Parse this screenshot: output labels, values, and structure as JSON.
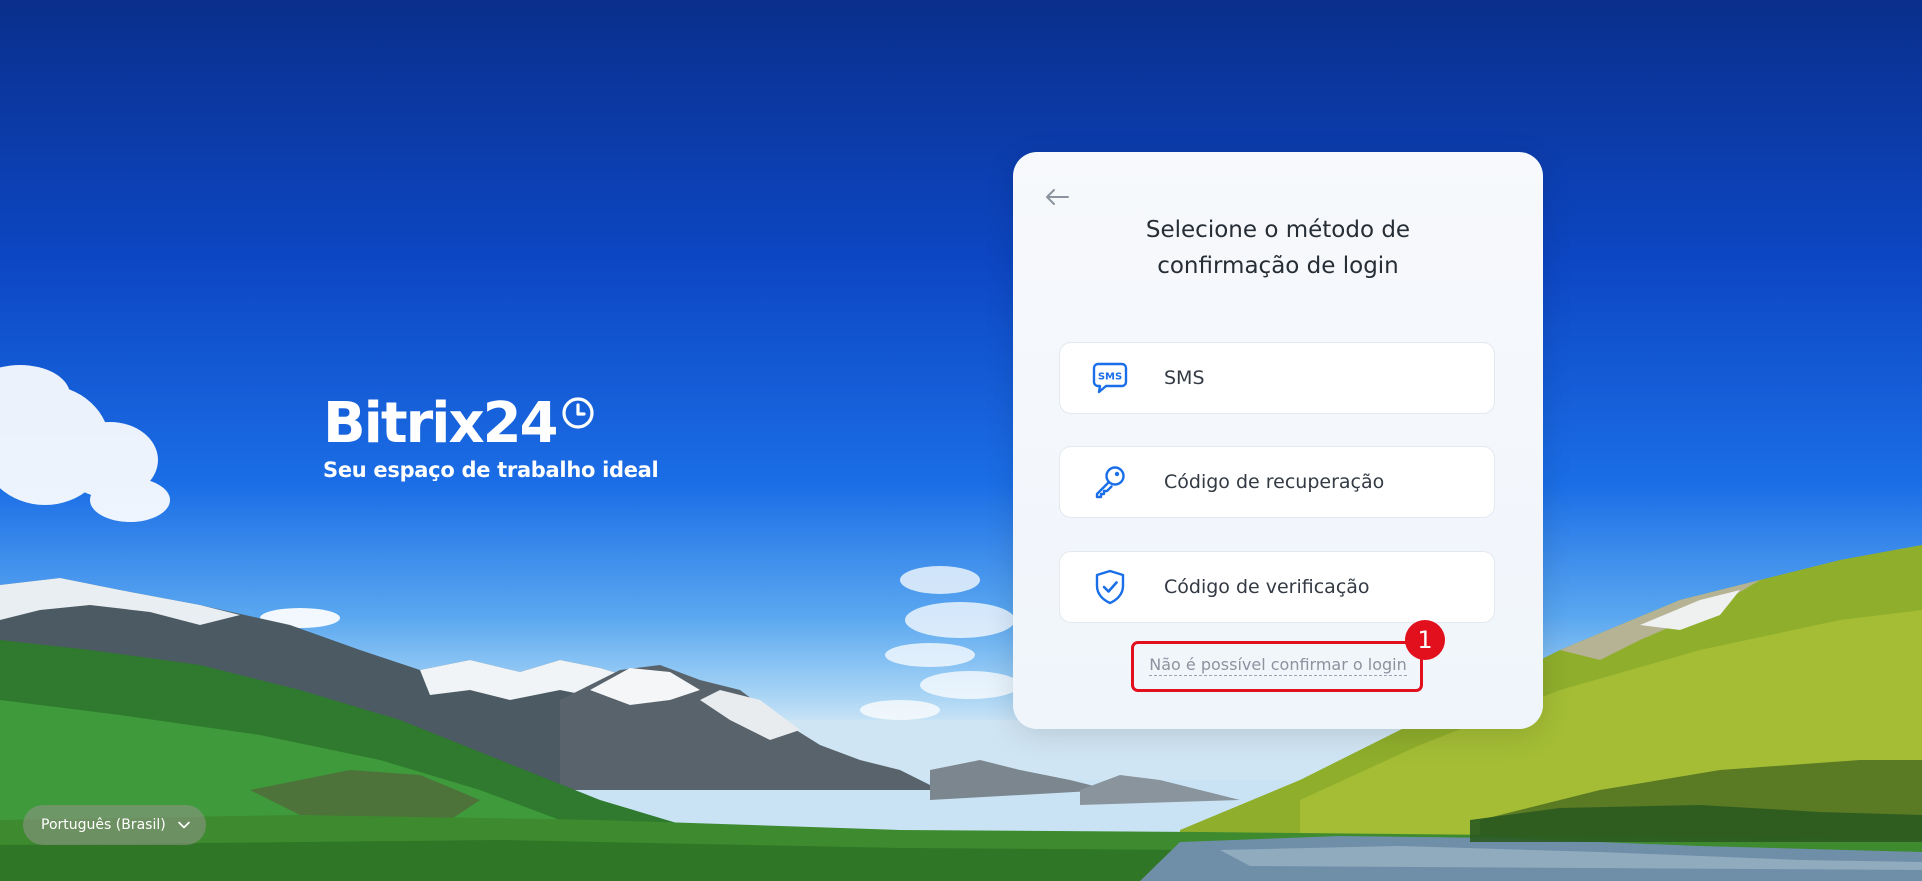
{
  "brand": {
    "name": "Bitrix24",
    "tagline": "Seu espaço de trabalho ideal"
  },
  "dialog": {
    "title_line1": "Selecione o método de",
    "title_line2": "confirmação de login",
    "methods": [
      {
        "label": "SMS",
        "icon": "sms-icon"
      },
      {
        "label": "Código de recuperação",
        "icon": "key-icon"
      },
      {
        "label": "Código de verificação",
        "icon": "shield-check-icon"
      }
    ],
    "cant_confirm_link": "Não é possível confirmar o login"
  },
  "annotation": {
    "step_number": "1",
    "color": "#e2101c"
  },
  "language_selector": {
    "value": "Português (Brasil)"
  },
  "colors": {
    "accent_blue": "#1a6fe8",
    "title_text": "#262d35"
  }
}
